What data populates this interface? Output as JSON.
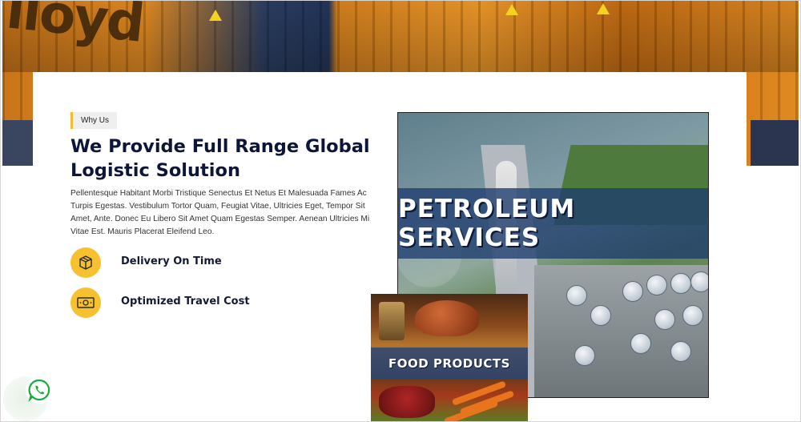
{
  "section": {
    "badge": "Why Us",
    "title": "We Provide Full Range Global Logistic Solution",
    "description": "Pellentesque Habitant Morbi Tristique Senectus Et Netus Et Malesuada Fames Ac Turpis Egestas. Vestibulum Tortor Quam, Feugiat Vitae, Ultricies Eget, Tempor Sit Amet, Ante. Donec Eu Libero Sit Amet Quam Egestas Semper. Aenean Ultricies Mi Vitae Est. Mauris Placerat Eleifend Leo."
  },
  "features": [
    {
      "label": "Delivery On Time",
      "icon": "package-box-icon"
    },
    {
      "label": "Optimized Travel Cost",
      "icon": "money-bill-icon"
    }
  ],
  "images": {
    "petroleum": {
      "title": "PETROLEUM SERVICES"
    },
    "food": {
      "title": "FOOD PRODUCTS"
    }
  },
  "hero": {
    "brand_fragment": "lloyd"
  },
  "colors": {
    "accent": "#f7c02e",
    "heading": "#0d1638",
    "banner_overlay": "#1e3c6e"
  },
  "widgets": {
    "whatsapp_icon": "whatsapp-icon"
  }
}
